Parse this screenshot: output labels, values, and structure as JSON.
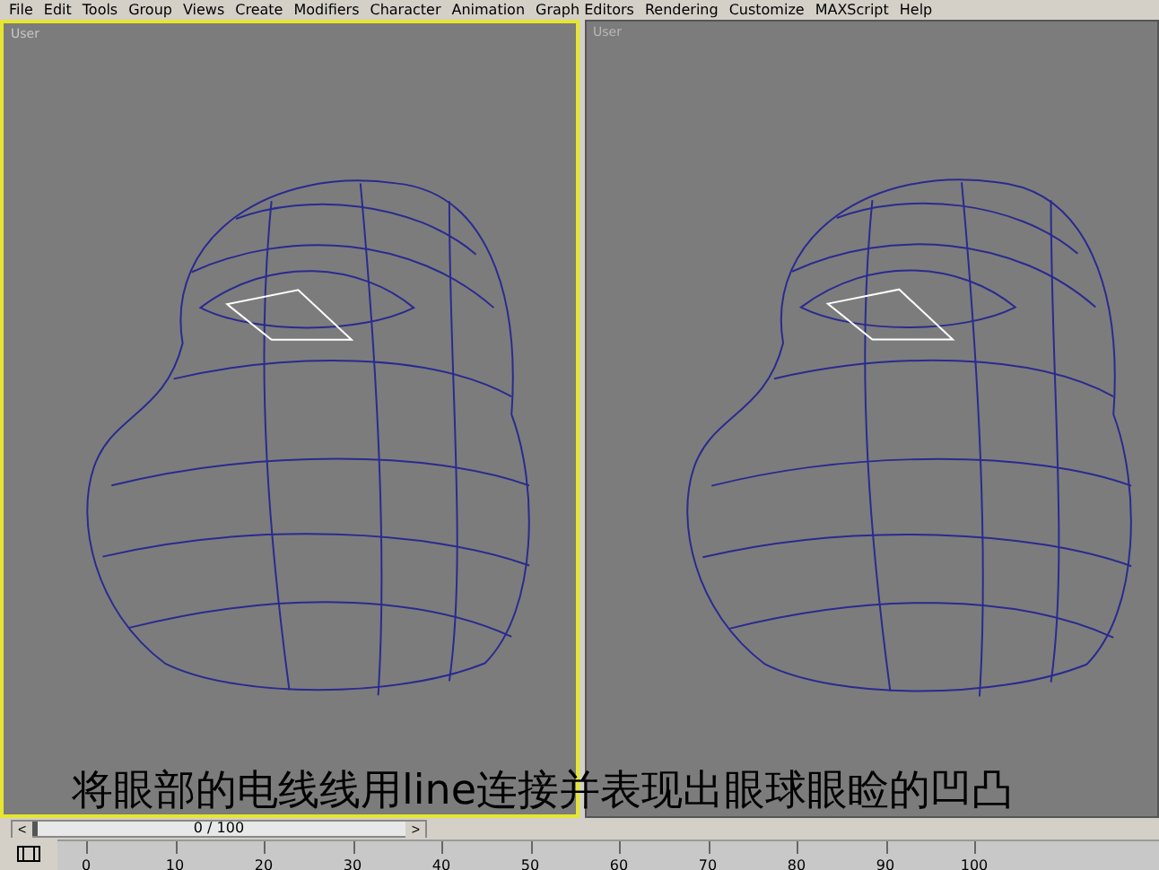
{
  "menu_bar": [
    "File",
    "Edit",
    "Tools",
    "Group",
    "Views",
    "Create",
    "Modifiers",
    "Character",
    "Animation",
    "Graph Editors",
    "Rendering",
    "Customize",
    "MAXScript",
    "Help"
  ],
  "viewports": [
    {
      "label": "User",
      "selected": true
    },
    {
      "label": "User",
      "selected": false
    }
  ],
  "caption": "将眼部的电线线用line连接并表现出眼球眼睑的凹凸",
  "time_slider": {
    "prev": "<",
    "position": "0 / 100",
    "next": ">",
    "level": 0
  },
  "track_bar": {
    "ticks": [
      "0",
      "10",
      "20",
      "30",
      "40",
      "50",
      "60",
      "70",
      "80",
      "90",
      "100"
    ]
  }
}
